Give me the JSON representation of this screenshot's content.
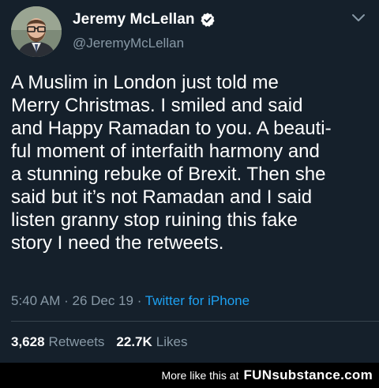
{
  "author": {
    "display_name": "Jeremy McLellan",
    "handle": "@JeremyMcLellan",
    "verified_icon": "verified-badge-icon"
  },
  "tweet": {
    "text": "A Muslim in London just told me\nMerry Christmas. I smiled and said\nand Happy Ramadan to you. A beauti-\nful moment of interfaith harmony and\na stunning rebuke of Brexit. Then she\nsaid but it’s not Ramadan and I said\nlisten granny stop ruining this fake\nstory I need the retweets.",
    "time": "5:40 AM",
    "separator": " · ",
    "date": "26 Dec 19",
    "source": "Twitter for iPhone"
  },
  "stats": {
    "retweets_count": "3,628",
    "retweets_label": "Retweets",
    "likes_count": "22.7K",
    "likes_label": "Likes"
  },
  "footer": {
    "text": "More like this at",
    "brand": "FUNsubstance.com"
  },
  "colors": {
    "background": "#15202b",
    "secondary_text": "#8899a6",
    "link": "#1da1f2",
    "verified": "#ffffff"
  }
}
